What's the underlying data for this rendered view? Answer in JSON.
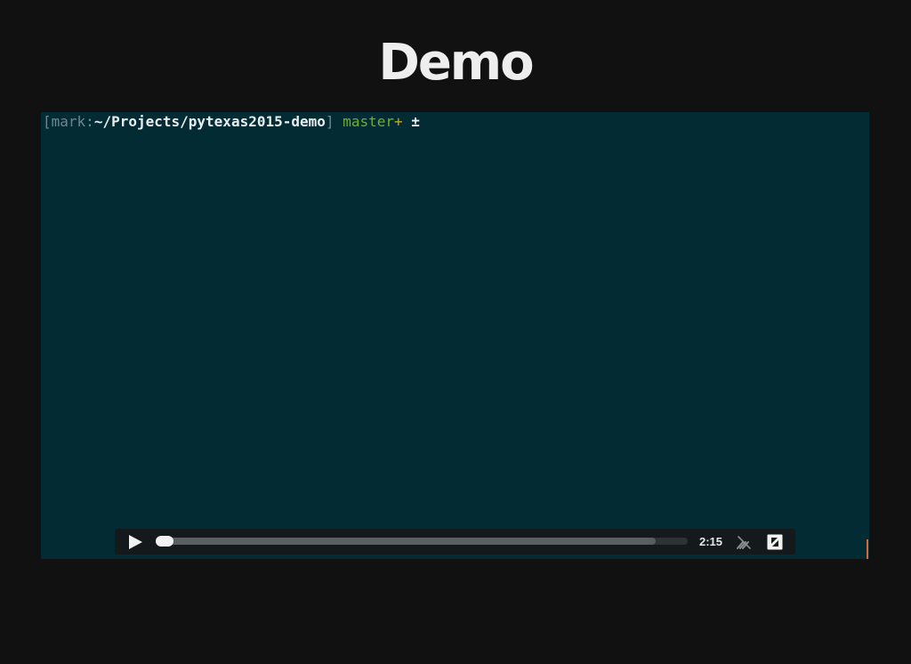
{
  "slide": {
    "title": "Demo"
  },
  "terminal": {
    "prompt": {
      "open_bracket": "[",
      "user": "mark",
      "colon": ":",
      "path": "~/Projects/pytexas2015-demo",
      "close_bracket": "]",
      "branch": "master",
      "branch_suffix": "+",
      "symbol": "±"
    },
    "background_color": "#022b33"
  },
  "player": {
    "time": "2:15",
    "progress_loaded": 0.94,
    "progress_played": 0.0,
    "icons": {
      "play": "play-icon",
      "speed": "speed-icon",
      "fullscreen": "fullscreen-icon"
    }
  }
}
